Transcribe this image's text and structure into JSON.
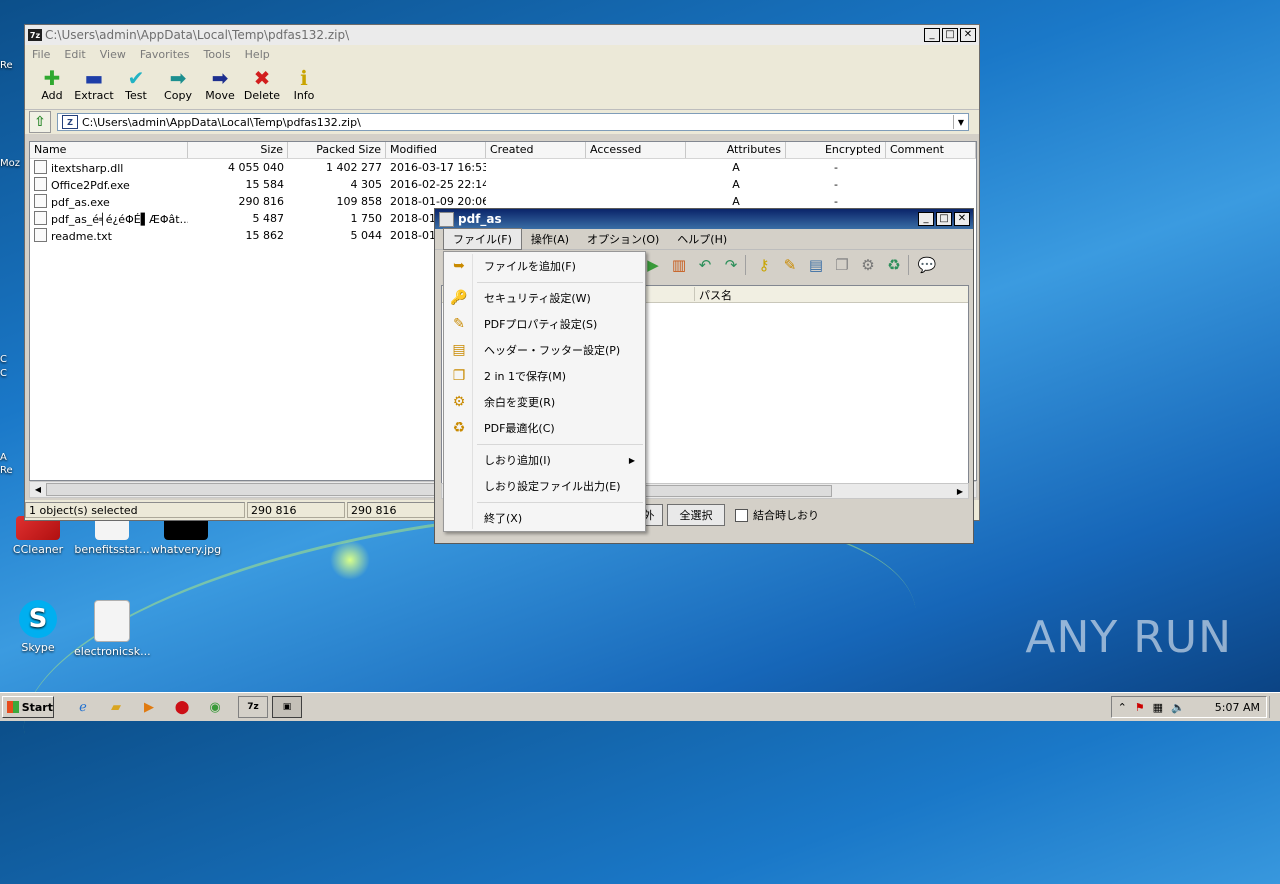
{
  "desktop": {
    "icons": [
      {
        "label": "CCleaner"
      },
      {
        "label": "benefitsstar..."
      },
      {
        "label": "whatvery.jpg"
      },
      {
        "label": "Skype"
      },
      {
        "label": "electronicsk..."
      }
    ],
    "edge_fragments": [
      "Re",
      "Moz",
      "C",
      "C",
      "A",
      "Re"
    ],
    "watermark": "ANY RUN"
  },
  "zip_window": {
    "title": "C:\\Users\\admin\\AppData\\Local\\Temp\\pdfas132.zip\\",
    "logo": "7z",
    "menu": [
      "File",
      "Edit",
      "View",
      "Favorites",
      "Tools",
      "Help"
    ],
    "toolbar": [
      {
        "label": "Add",
        "icon": "plus-icon",
        "glyph": "✚",
        "color": "#2fa82f"
      },
      {
        "label": "Extract",
        "icon": "minus-icon",
        "glyph": "▬",
        "color": "#1e3ea8"
      },
      {
        "label": "Test",
        "icon": "check-icon",
        "glyph": "✔",
        "color": "#22b3c4"
      },
      {
        "label": "Copy",
        "icon": "copy-arrow-icon",
        "glyph": "➡",
        "color": "#1c8f8f"
      },
      {
        "label": "Move",
        "icon": "move-arrow-icon",
        "glyph": "➡",
        "color": "#1d2f8f"
      },
      {
        "label": "Delete",
        "icon": "delete-x-icon",
        "glyph": "✖",
        "color": "#d21e1e"
      },
      {
        "label": "Info",
        "icon": "info-icon",
        "glyph": "ℹ",
        "color": "#c9a400"
      }
    ],
    "address": "C:\\Users\\admin\\AppData\\Local\\Temp\\pdfas132.zip\\",
    "columns": [
      "Name",
      "Size",
      "Packed Size",
      "Modified",
      "Created",
      "Accessed",
      "Attributes",
      "Encrypted",
      "Comment"
    ],
    "rows": [
      {
        "name": "itextsharp.dll",
        "size": "4 055 040",
        "packed": "1 402 277",
        "modified": "2016-03-17 16:53",
        "attributes": "A",
        "encrypted": "-"
      },
      {
        "name": "Office2Pdf.exe",
        "size": "15 584",
        "packed": "4 305",
        "modified": "2016-02-25 22:14",
        "attributes": "A",
        "encrypted": "-"
      },
      {
        "name": "pdf_as.exe",
        "size": "290 816",
        "packed": "109 858",
        "modified": "2018-01-09 20:06",
        "attributes": "A",
        "encrypted": "-"
      },
      {
        "name": "pdf_as_é╡é¿éΦÉ▌ÆΦât...",
        "size": "5 487",
        "packed": "1 750",
        "modified": "2018-01",
        "attributes": "",
        "encrypted": ""
      },
      {
        "name": "readme.txt",
        "size": "15 862",
        "packed": "5 044",
        "modified": "2018-01",
        "attributes": "",
        "encrypted": ""
      }
    ],
    "status": [
      "1 object(s) selected",
      "290 816",
      "290 816"
    ]
  },
  "pdf_window": {
    "title": "pdf_as",
    "menu": [
      "ファイル(F)",
      "操作(A)",
      "オプション(O)",
      "ヘルプ(H)"
    ],
    "list_header": "パス名",
    "buttons": [
      "外",
      "全選択"
    ],
    "checkbox_label": "結合時しおり"
  },
  "context_menu": {
    "items": [
      {
        "label": "ファイルを追加(F)",
        "icon": "add-file-icon",
        "glyph": "➥"
      },
      {
        "label": "セキュリティ設定(W)",
        "icon": "key-icon",
        "glyph": "🔑"
      },
      {
        "label": "PDFプロパティ設定(S)",
        "icon": "properties-icon",
        "glyph": "✎"
      },
      {
        "label": "ヘッダー・フッター設定(P)",
        "icon": "header-footer-icon",
        "glyph": "▤"
      },
      {
        "label": "2 in 1で保存(M)",
        "icon": "two-in-one-icon",
        "glyph": "❐"
      },
      {
        "label": "余白を変更(R)",
        "icon": "margin-gear-icon",
        "glyph": "⚙"
      },
      {
        "label": "PDF最適化(C)",
        "icon": "optimize-icon",
        "glyph": "♻"
      },
      {
        "label": "しおり追加(I)",
        "icon": "",
        "glyph": ""
      },
      {
        "label": "しおり設定ファイル出力(E)",
        "icon": "",
        "glyph": ""
      },
      {
        "label": "終了(X)",
        "icon": "",
        "glyph": ""
      }
    ]
  },
  "taskbar": {
    "start_label": "Start",
    "clock": "5:07 AM"
  }
}
